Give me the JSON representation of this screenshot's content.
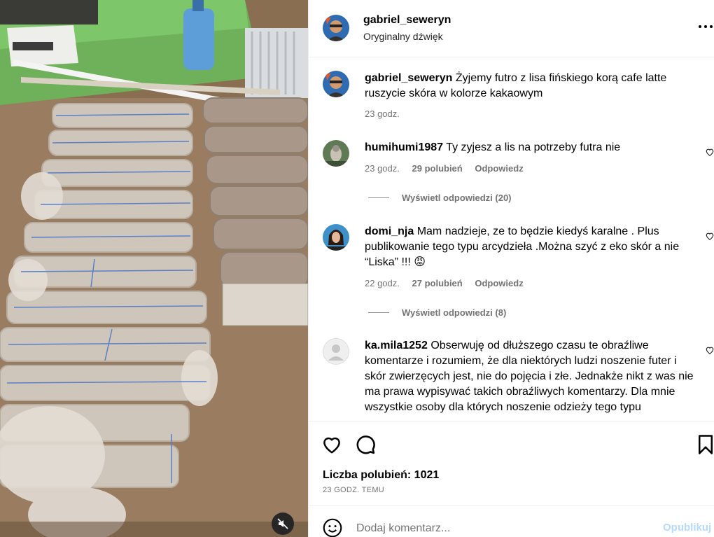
{
  "header": {
    "username": "gabriel_seweryn",
    "audio": "Oryginalny dźwięk"
  },
  "caption": {
    "username": "gabriel_seweryn",
    "text": "Żyjemy futro z lisa fińskiego korą cafe latte ruszycie skóra w kolorze kakaowym",
    "time": "23 godz."
  },
  "comments": [
    {
      "username": "humihumi1987",
      "text": "Ty zyjesz a lis na potrzeby futra nie",
      "time": "23 godz.",
      "likes": "29 polubień",
      "reply": "Odpowiedz",
      "view_replies": "Wyświetl odpowiedzi (20)"
    },
    {
      "username": "domi_nja",
      "text": "Mam nadzieje, ze to będzie kiedyś karalne . Plus publikowanie tego typu arcydzieła .Można szyć z eko skór a nie “Liska” !!! 😡",
      "time": "22 godz.",
      "likes": "27 polubień",
      "reply": "Odpowiedz",
      "view_replies": "Wyświetl odpowiedzi (8)"
    },
    {
      "username": "ka.mila1252",
      "text": "Obserwuję od dłuższego czasu te obraźliwe komentarze i rozumiem, że dla niektórych ludzi noszenie futer i skór zwierzęcych jest, nie do pojęcia i złe. Jednakże nikt z was nie ma prawa wypisywać takich obraźliwych komentarzy. Dla mnie wszystkie osoby dla których noszenie odzieży tego typu"
    }
  ],
  "stats": {
    "likes": "Liczba polubień: 1021",
    "time_ago": "23 GODZ. TEMU"
  },
  "compose": {
    "placeholder": "Dodaj komentarz...",
    "post_label": "Opublikuj"
  },
  "icons": {
    "more": "more-options-icon",
    "like": "heart-icon",
    "comment": "comment-icon",
    "save": "bookmark-icon",
    "emoji": "emoji-icon",
    "mute": "muted-speaker-icon"
  },
  "colors": {
    "link_disabled": "#b3dbff",
    "secondary_text": "#737373",
    "divider": "#efefef"
  }
}
